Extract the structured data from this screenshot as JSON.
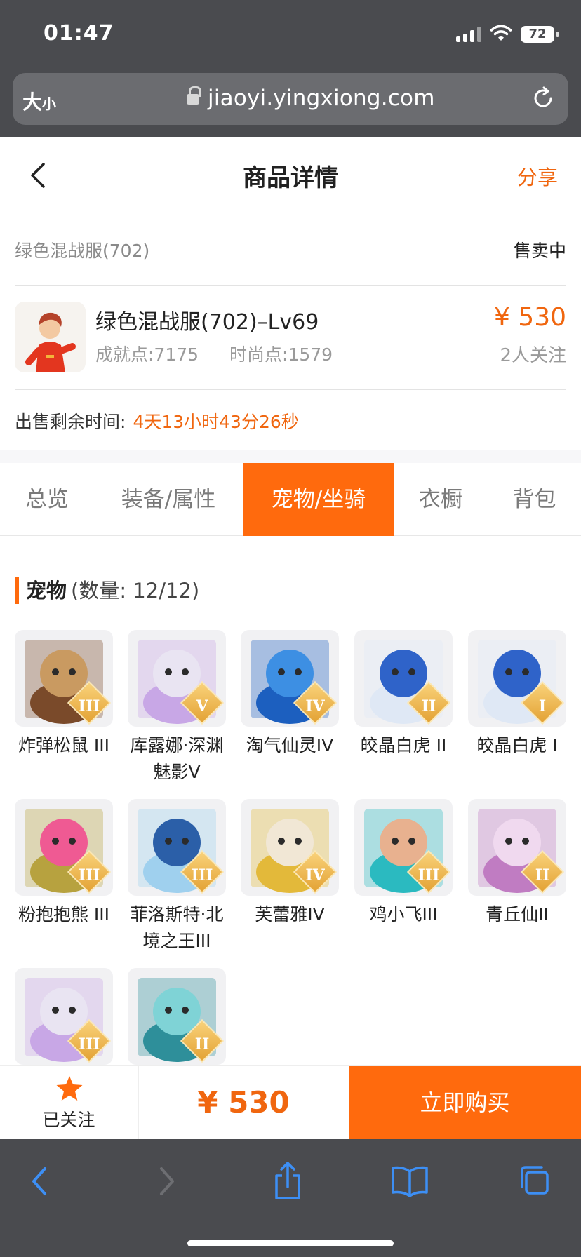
{
  "status_bar": {
    "time": "01:47",
    "battery": "72"
  },
  "browser": {
    "text_size_label_big": "大",
    "text_size_label_small": "小",
    "url": "jiaoyi.yingxiong.com"
  },
  "header": {
    "title": "商品详情",
    "share": "分享"
  },
  "listing": {
    "server": "绿色混战服(702)",
    "status": "售卖中",
    "product_name": "绿色混战服(702)–Lv69",
    "achievement_points": "成就点:7175",
    "fashion_points": "时尚点:1579",
    "price": "¥ 530",
    "followers": "2人关注",
    "countdown_label": "出售剩余时间:",
    "countdown_value": "4天13小时43分26秒"
  },
  "tabs": [
    {
      "label": "总览",
      "active": false
    },
    {
      "label": "装备/属性",
      "active": false
    },
    {
      "label": "宠物/坐骑",
      "active": true
    },
    {
      "label": "衣橱",
      "active": false
    },
    {
      "label": "背包",
      "active": false
    }
  ],
  "pets_section": {
    "title": "宠物",
    "count": "(数量: 12/12)"
  },
  "pets": [
    {
      "name": "炸弹松鼠 III",
      "rank": "III",
      "colors": [
        "#c99a61",
        "#7a4a2a"
      ]
    },
    {
      "name": "库露娜·深渊魅影V",
      "rank": "V",
      "colors": [
        "#e9e4f2",
        "#c8a7e6"
      ]
    },
    {
      "name": "淘气仙灵IV",
      "rank": "IV",
      "colors": [
        "#3d8fe3",
        "#1c5fbf"
      ]
    },
    {
      "name": "皎晶白虎 II",
      "rank": "II",
      "colors": [
        "#2f63c9",
        "#dfe8f5"
      ]
    },
    {
      "name": "皎晶白虎 I",
      "rank": "I",
      "colors": [
        "#2f63c9",
        "#dfe8f5"
      ]
    },
    {
      "name": "粉抱抱熊 III",
      "rank": "III",
      "colors": [
        "#ef5a93",
        "#b7a23f"
      ]
    },
    {
      "name": "菲洛斯特·北境之王III",
      "rank": "III",
      "colors": [
        "#2b5fa8",
        "#9fd0ee"
      ]
    },
    {
      "name": "芙蕾雅IV",
      "rank": "IV",
      "colors": [
        "#f1e7d5",
        "#e3b93a"
      ]
    },
    {
      "name": "鸡小飞III",
      "rank": "III",
      "colors": [
        "#e8b18f",
        "#2bbac0"
      ]
    },
    {
      "name": "青丘仙II",
      "rank": "II",
      "colors": [
        "#f0d9ef",
        "#c07cc2"
      ]
    },
    {
      "name": "",
      "rank": "III",
      "colors": [
        "#e9e4f2",
        "#c8a7e6"
      ]
    },
    {
      "name": "",
      "rank": "II",
      "colors": [
        "#7fd3d6",
        "#2e8f9a"
      ]
    }
  ],
  "bottom_bar": {
    "follow_label": "已关注",
    "price": "¥ 530",
    "buy_label": "立即购买"
  },
  "colors": {
    "accent": "#ff6a0d",
    "chrome": "#4a4b4f",
    "link_blue": "#3d8ff5"
  }
}
